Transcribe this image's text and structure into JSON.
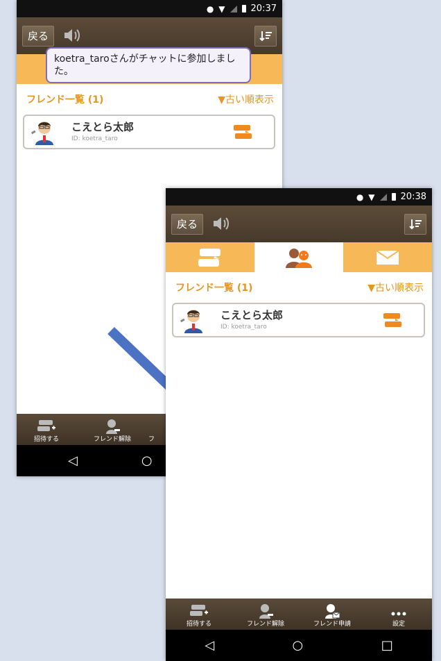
{
  "screen1": {
    "status_time": "20:37",
    "back_label": "戻る",
    "toast": "koetra_taroさんがチャットに参加しました。",
    "list_title": "フレンド一覧 (1)",
    "sort_label": "▼古い順表示",
    "friend": {
      "name": "こえとら太郎",
      "id": "ID: koetra_taro"
    },
    "bottom": {
      "invite": "招待する",
      "unfriend": "フレンド解除",
      "partial": "フ"
    }
  },
  "screen2": {
    "status_time": "20:38",
    "back_label": "戻る",
    "list_title": "フレンド一覧 (1)",
    "sort_label": "▼古い順表示",
    "friend": {
      "name": "こえとら太郎",
      "id": "ID: koetra_taro"
    },
    "bottom": {
      "invite": "招待する",
      "unfriend": "フレンド解除",
      "request": "フレンド申請",
      "settings": "設定"
    },
    "nav": {
      "back": "◁",
      "home": "○",
      "recent": "□"
    }
  },
  "icons": [
    "location-icon",
    "wifi-icon",
    "signal-icon",
    "battery-icon",
    "speaker-icon",
    "sort-icon",
    "chat-icon",
    "friends-icon",
    "mail-icon",
    "invite-icon",
    "unfriend-icon",
    "friend-request-icon",
    "more-icon",
    "arrow-icon"
  ],
  "colors": {
    "accent": "#f7b957",
    "orange": "#e8961b",
    "toolbar": "#4e4030",
    "toast_border": "#7b6cc4"
  }
}
